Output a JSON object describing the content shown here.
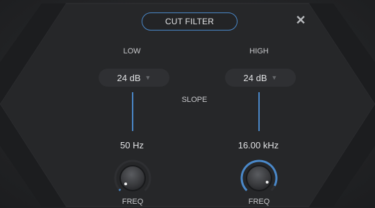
{
  "header": {
    "title": "CUT FILTER",
    "close_icon": "close-icon"
  },
  "low": {
    "title": "LOW",
    "slope": "24 dB",
    "freq_value": "50 Hz",
    "freq_label": "FREQ",
    "knob_level": 0.02
  },
  "high": {
    "title": "HIGH",
    "slope": "24 dB",
    "freq_value": "16.00 kHz",
    "freq_label": "FREQ",
    "knob_level": 0.93
  },
  "slope_label": "SLOPE",
  "colors": {
    "accent": "#4a88c9",
    "background": "#1e1f21",
    "control": "#2f3033"
  }
}
